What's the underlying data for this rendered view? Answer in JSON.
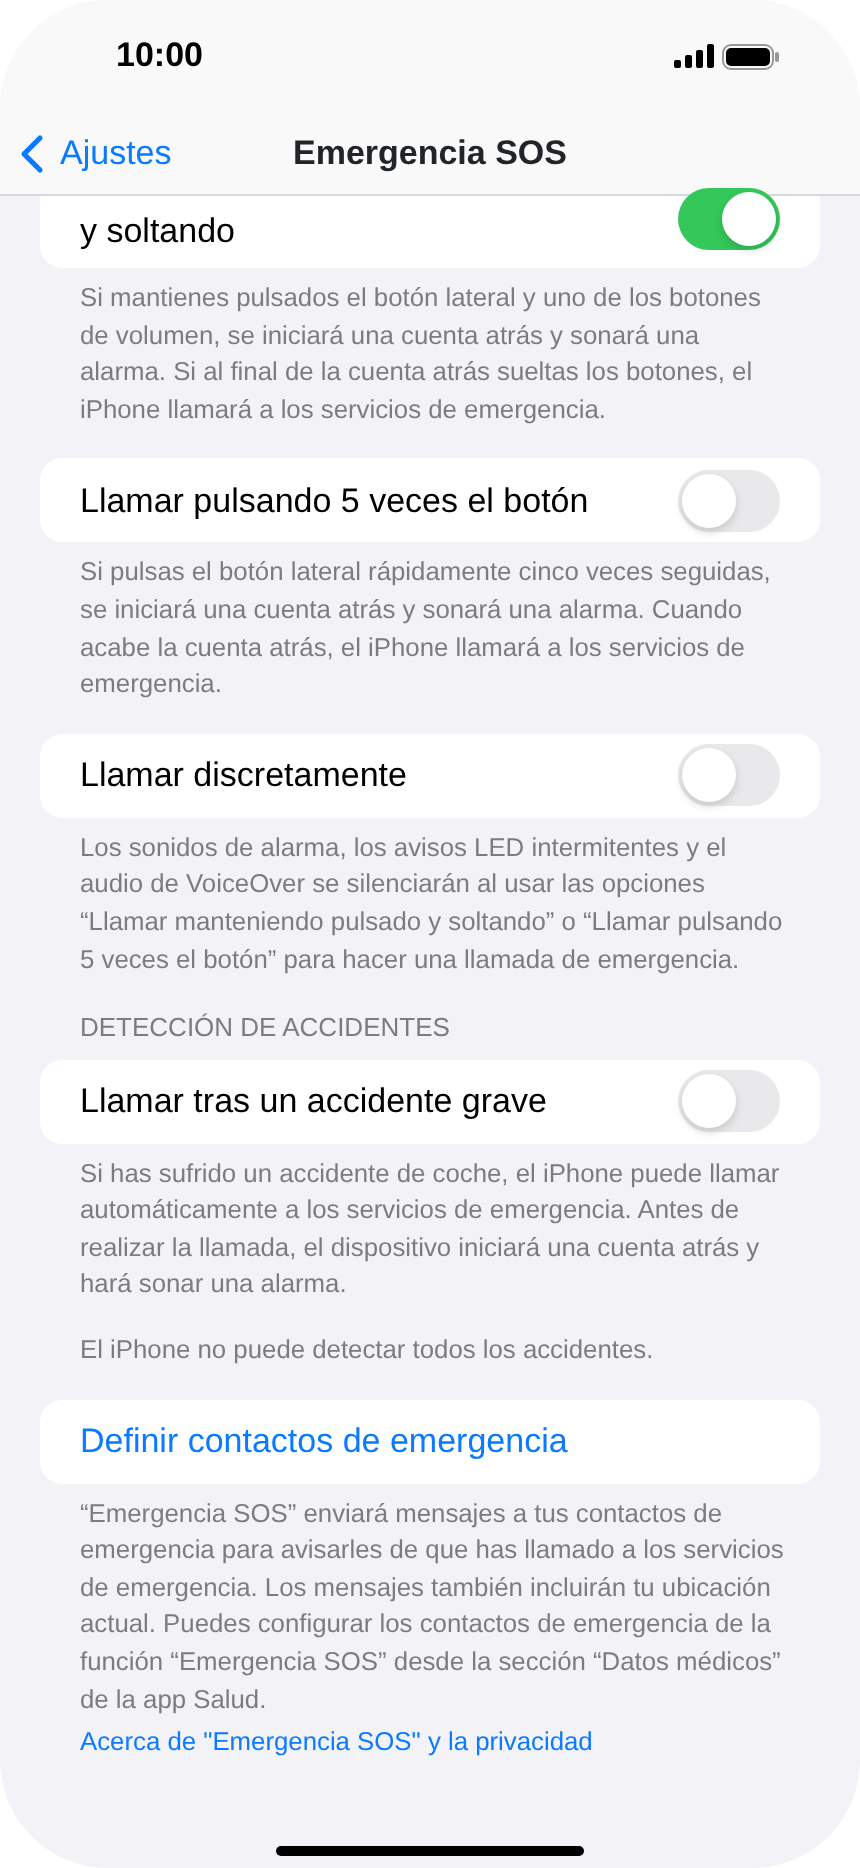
{
  "status_bar": {
    "time": "10:00"
  },
  "nav": {
    "back": "Ajustes",
    "title": "Emergencia SOS"
  },
  "sections": [
    {
      "rows": [
        {
          "kind": "toggle",
          "label": "y soltando",
          "on": true
        }
      ],
      "footer": [
        {
          "kind": "text",
          "text": "Si mantienes pulsados el botón lateral y uno de los botones de volumen, se iniciará una cuenta atrás y sonará una alarma. Si al final de la cuenta atrás sueltas los botones, el iPhone llamará a los servicios de emergencia."
        }
      ]
    },
    {
      "rows": [
        {
          "kind": "toggle",
          "label": "Llamar pulsando 5 veces el botón",
          "on": false
        }
      ],
      "footer": [
        {
          "kind": "text",
          "text": "Si pulsas el botón lateral rápidamente cinco veces seguidas, se iniciará una cuenta atrás y sonará una alarma. Cuando acabe la cuenta atrás, el iPhone llamará a los servicios de emergencia."
        }
      ]
    },
    {
      "rows": [
        {
          "kind": "toggle",
          "label": "Llamar discretamente",
          "on": false
        }
      ],
      "footer": [
        {
          "kind": "text",
          "text": "Los sonidos de alarma, los avisos LED intermitentes y el audio de VoiceOver se silenciarán al usar las opciones “Llamar manteniendo pulsado y soltando” o “Llamar pulsando 5 veces el botón” para hacer una llamada de emergencia."
        }
      ]
    },
    {
      "header": "DETECCIÓN DE ACCIDENTES",
      "rows": [
        {
          "kind": "toggle",
          "label": "Llamar tras un accidente grave",
          "on": false
        }
      ],
      "footer": [
        {
          "kind": "text",
          "text": "Si has sufrido un accidente de coche, el iPhone puede llamar automáticamente a los servicios de emergencia. Antes de realizar la llamada, el dispositivo iniciará una cuenta atrás y hará sonar una alarma."
        },
        {
          "kind": "text",
          "text": "El iPhone no puede detectar todos los accidentes."
        }
      ]
    },
    {
      "rows": [
        {
          "kind": "link",
          "label": "Definir contactos de emergencia"
        }
      ],
      "footer": [
        {
          "kind": "text",
          "text": "“Emergencia SOS” enviará mensajes a tus contactos de emergencia para avisarles de que has llamado a los servicios de emergencia. Los mensajes también incluirán tu ubicación actual. Puedes configurar los contactos de emergencia de la función “Emergencia SOS” desde la sección “Datos médicos” de la app Salud."
        },
        {
          "kind": "link",
          "text": "Acerca de \"Emergencia SOS\" y la privacidad"
        }
      ]
    }
  ]
}
